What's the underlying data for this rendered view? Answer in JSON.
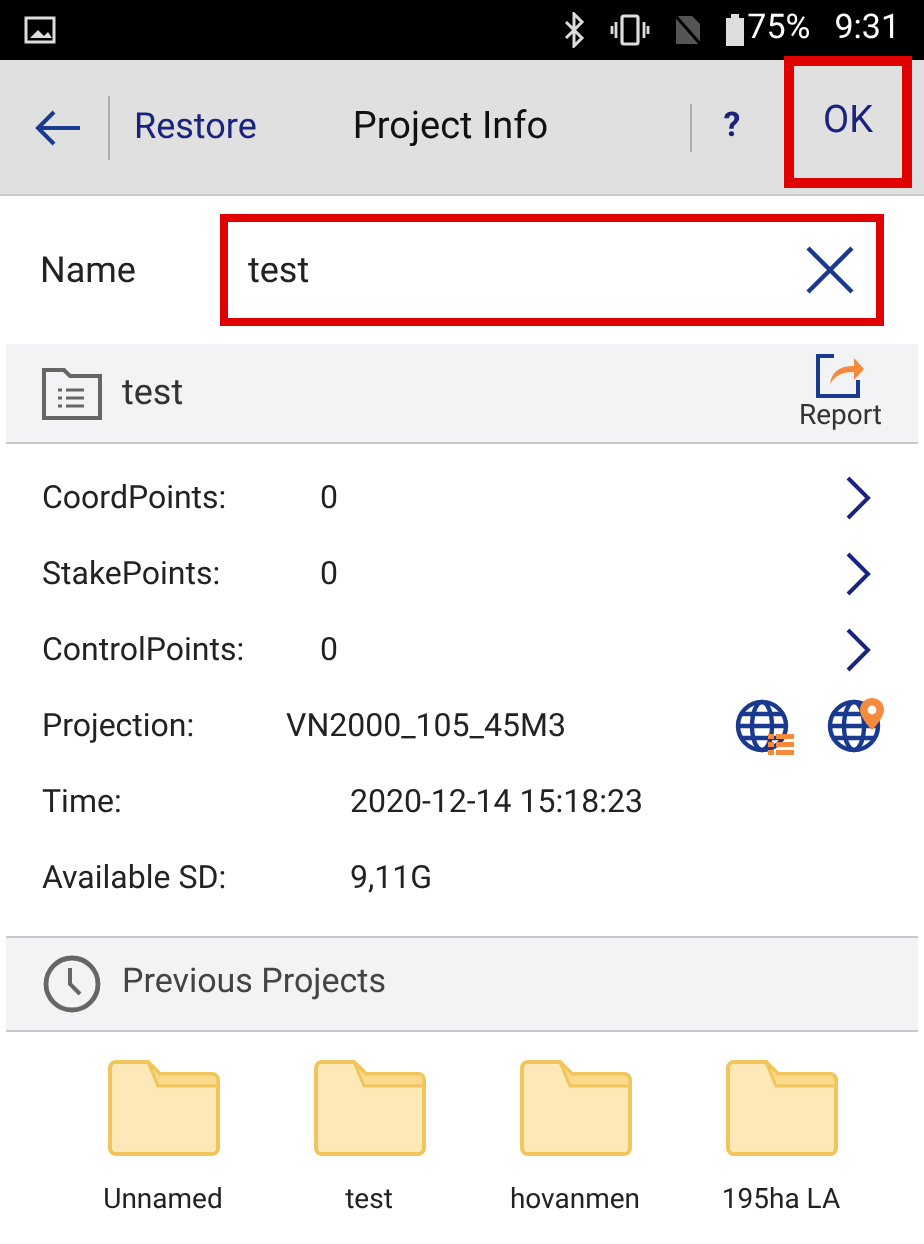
{
  "status_bar": {
    "battery": "75%",
    "time": "9:31"
  },
  "toolbar": {
    "back_label": "Restore",
    "title": "Project Info",
    "help": "?",
    "ok": {
      "label": "OK",
      "highlighted": true
    }
  },
  "name_field": {
    "label": "Name",
    "value": "test",
    "highlighted": true
  },
  "project": {
    "name": "test",
    "report_label": "Report"
  },
  "rows": [
    {
      "kind": "count",
      "label": "CoordPoints:",
      "value": "0"
    },
    {
      "kind": "count",
      "label": "StakePoints:",
      "value": "0"
    },
    {
      "kind": "count",
      "label": "ControlPoints:",
      "value": "0"
    },
    {
      "kind": "projection",
      "label": "Projection:",
      "value": "VN2000_105_45M3"
    },
    {
      "kind": "plain",
      "label": "Time:",
      "value": "2020-12-14 15:18:23"
    },
    {
      "kind": "plain",
      "label": "Available SD:",
      "value": "9,11G"
    }
  ],
  "previous": {
    "title": "Previous Projects",
    "items": [
      {
        "name": "Unnamed"
      },
      {
        "name": "test"
      },
      {
        "name": "hovanmen"
      },
      {
        "name": "195ha LA"
      }
    ]
  }
}
